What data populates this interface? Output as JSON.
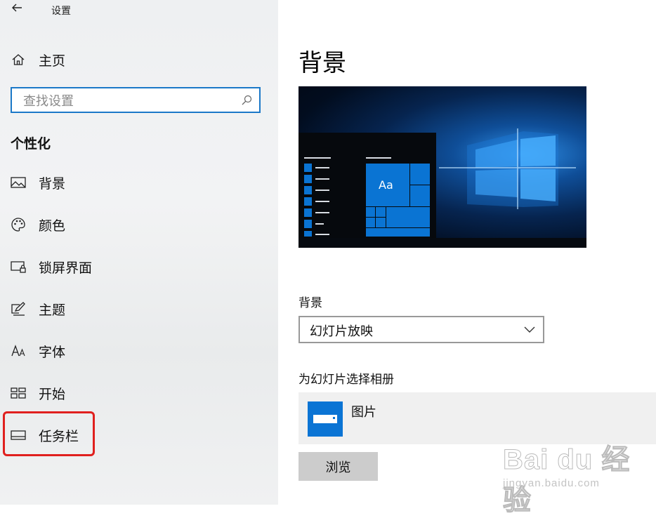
{
  "window": {
    "title": "设置",
    "back_icon": "arrow-left-icon"
  },
  "sidebar": {
    "home": {
      "label": "主页",
      "icon": "home-icon"
    },
    "search": {
      "placeholder": "查找设置",
      "icon": "search-icon"
    },
    "section_heading": "个性化",
    "items": [
      {
        "label": "背景",
        "icon": "image-icon"
      },
      {
        "label": "颜色",
        "icon": "palette-icon"
      },
      {
        "label": "锁屏界面",
        "icon": "lock-screen-icon"
      },
      {
        "label": "主题",
        "icon": "theme-icon"
      },
      {
        "label": "字体",
        "icon": "font-icon"
      },
      {
        "label": "开始",
        "icon": "start-icon"
      },
      {
        "label": "任务栏",
        "icon": "taskbar-icon",
        "highlighted": true
      }
    ]
  },
  "main": {
    "title": "背景",
    "preview": {
      "tile_text": "Aa"
    },
    "background_field": {
      "label": "背景",
      "selected": "幻灯片放映"
    },
    "album": {
      "label": "为幻灯片选择相册",
      "item_name": "图片",
      "item_icon": "pictures-folder-icon"
    },
    "browse_button": "浏览"
  },
  "watermark": {
    "main": "Bai du 经验",
    "sub": "jingyan.baidu.com"
  },
  "colors": {
    "accent": "#0078d7",
    "highlight": "#e0201e"
  }
}
